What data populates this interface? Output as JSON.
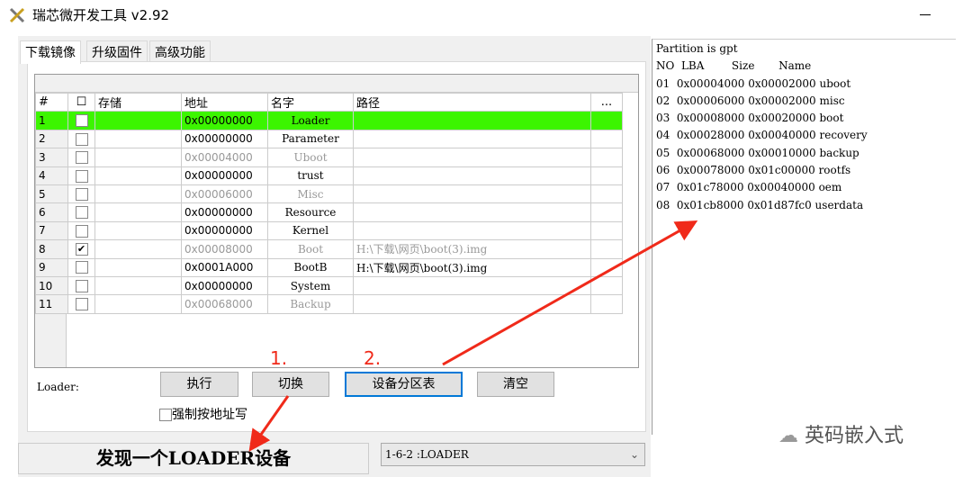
{
  "window": {
    "title": "瑞芯微开发工具 v2.92"
  },
  "tabs": [
    "下载镜像",
    "升级固件",
    "高级功能"
  ],
  "table": {
    "headers": [
      "#",
      "☐",
      "存储",
      "地址",
      "名字",
      "路径",
      "..."
    ],
    "rows": [
      {
        "no": "1",
        "checked": false,
        "addr": "0x00000000",
        "name": "Loader",
        "path": "",
        "selected": true,
        "dim": false
      },
      {
        "no": "2",
        "checked": false,
        "addr": "0x00000000",
        "name": "Parameter",
        "path": "",
        "selected": false,
        "dim": false
      },
      {
        "no": "3",
        "checked": false,
        "addr": "0x00004000",
        "name": "Uboot",
        "path": "",
        "selected": false,
        "dim": true
      },
      {
        "no": "4",
        "checked": false,
        "addr": "0x00000000",
        "name": "trust",
        "path": "",
        "selected": false,
        "dim": false
      },
      {
        "no": "5",
        "checked": false,
        "addr": "0x00006000",
        "name": "Misc",
        "path": "",
        "selected": false,
        "dim": true
      },
      {
        "no": "6",
        "checked": false,
        "addr": "0x00000000",
        "name": "Resource",
        "path": "",
        "selected": false,
        "dim": false
      },
      {
        "no": "7",
        "checked": false,
        "addr": "0x00000000",
        "name": "Kernel",
        "path": "",
        "selected": false,
        "dim": false
      },
      {
        "no": "8",
        "checked": true,
        "addr": "0x00008000",
        "name": "Boot",
        "path": "H:\\下载\\网页\\boot(3).img",
        "selected": false,
        "dim": true
      },
      {
        "no": "9",
        "checked": false,
        "addr": "0x0001A000",
        "name": "BootB",
        "path": "H:\\下载\\网页\\boot(3).img",
        "selected": false,
        "dim": false
      },
      {
        "no": "10",
        "checked": false,
        "addr": "0x00000000",
        "name": "System",
        "path": "",
        "selected": false,
        "dim": false
      },
      {
        "no": "11",
        "checked": false,
        "addr": "0x00068000",
        "name": "Backup",
        "path": "",
        "selected": false,
        "dim": true
      }
    ]
  },
  "loader_label": "Loader:",
  "buttons": {
    "run": "执行",
    "switch": "切换",
    "partition": "设备分区表",
    "clear": "清空"
  },
  "force_addr": {
    "label": "强制按地址写",
    "checked": false
  },
  "status": "发现一个LOADER设备",
  "device_select": {
    "value": "1-6-2 :LOADER"
  },
  "log": [
    "Partition is gpt",
    "NO  LBA        Size       Name",
    "01  0x00004000 0x00002000 uboot",
    "02  0x00006000 0x00002000 misc",
    "03  0x00008000 0x00020000 boot",
    "04  0x00028000 0x00040000 recovery",
    "05  0x00068000 0x00010000 backup",
    "06  0x00078000 0x01c00000 rootfs",
    "07  0x01c78000 0x00040000 oem",
    "08  0x01cb8000 0x01d87fc0 userdata"
  ],
  "annotations": [
    "1.",
    "2."
  ],
  "watermark": "英码嵌入式",
  "colors": {
    "selected_row": "#3cf500",
    "annotation": "#f02a1a",
    "focus": "#0078d7"
  }
}
